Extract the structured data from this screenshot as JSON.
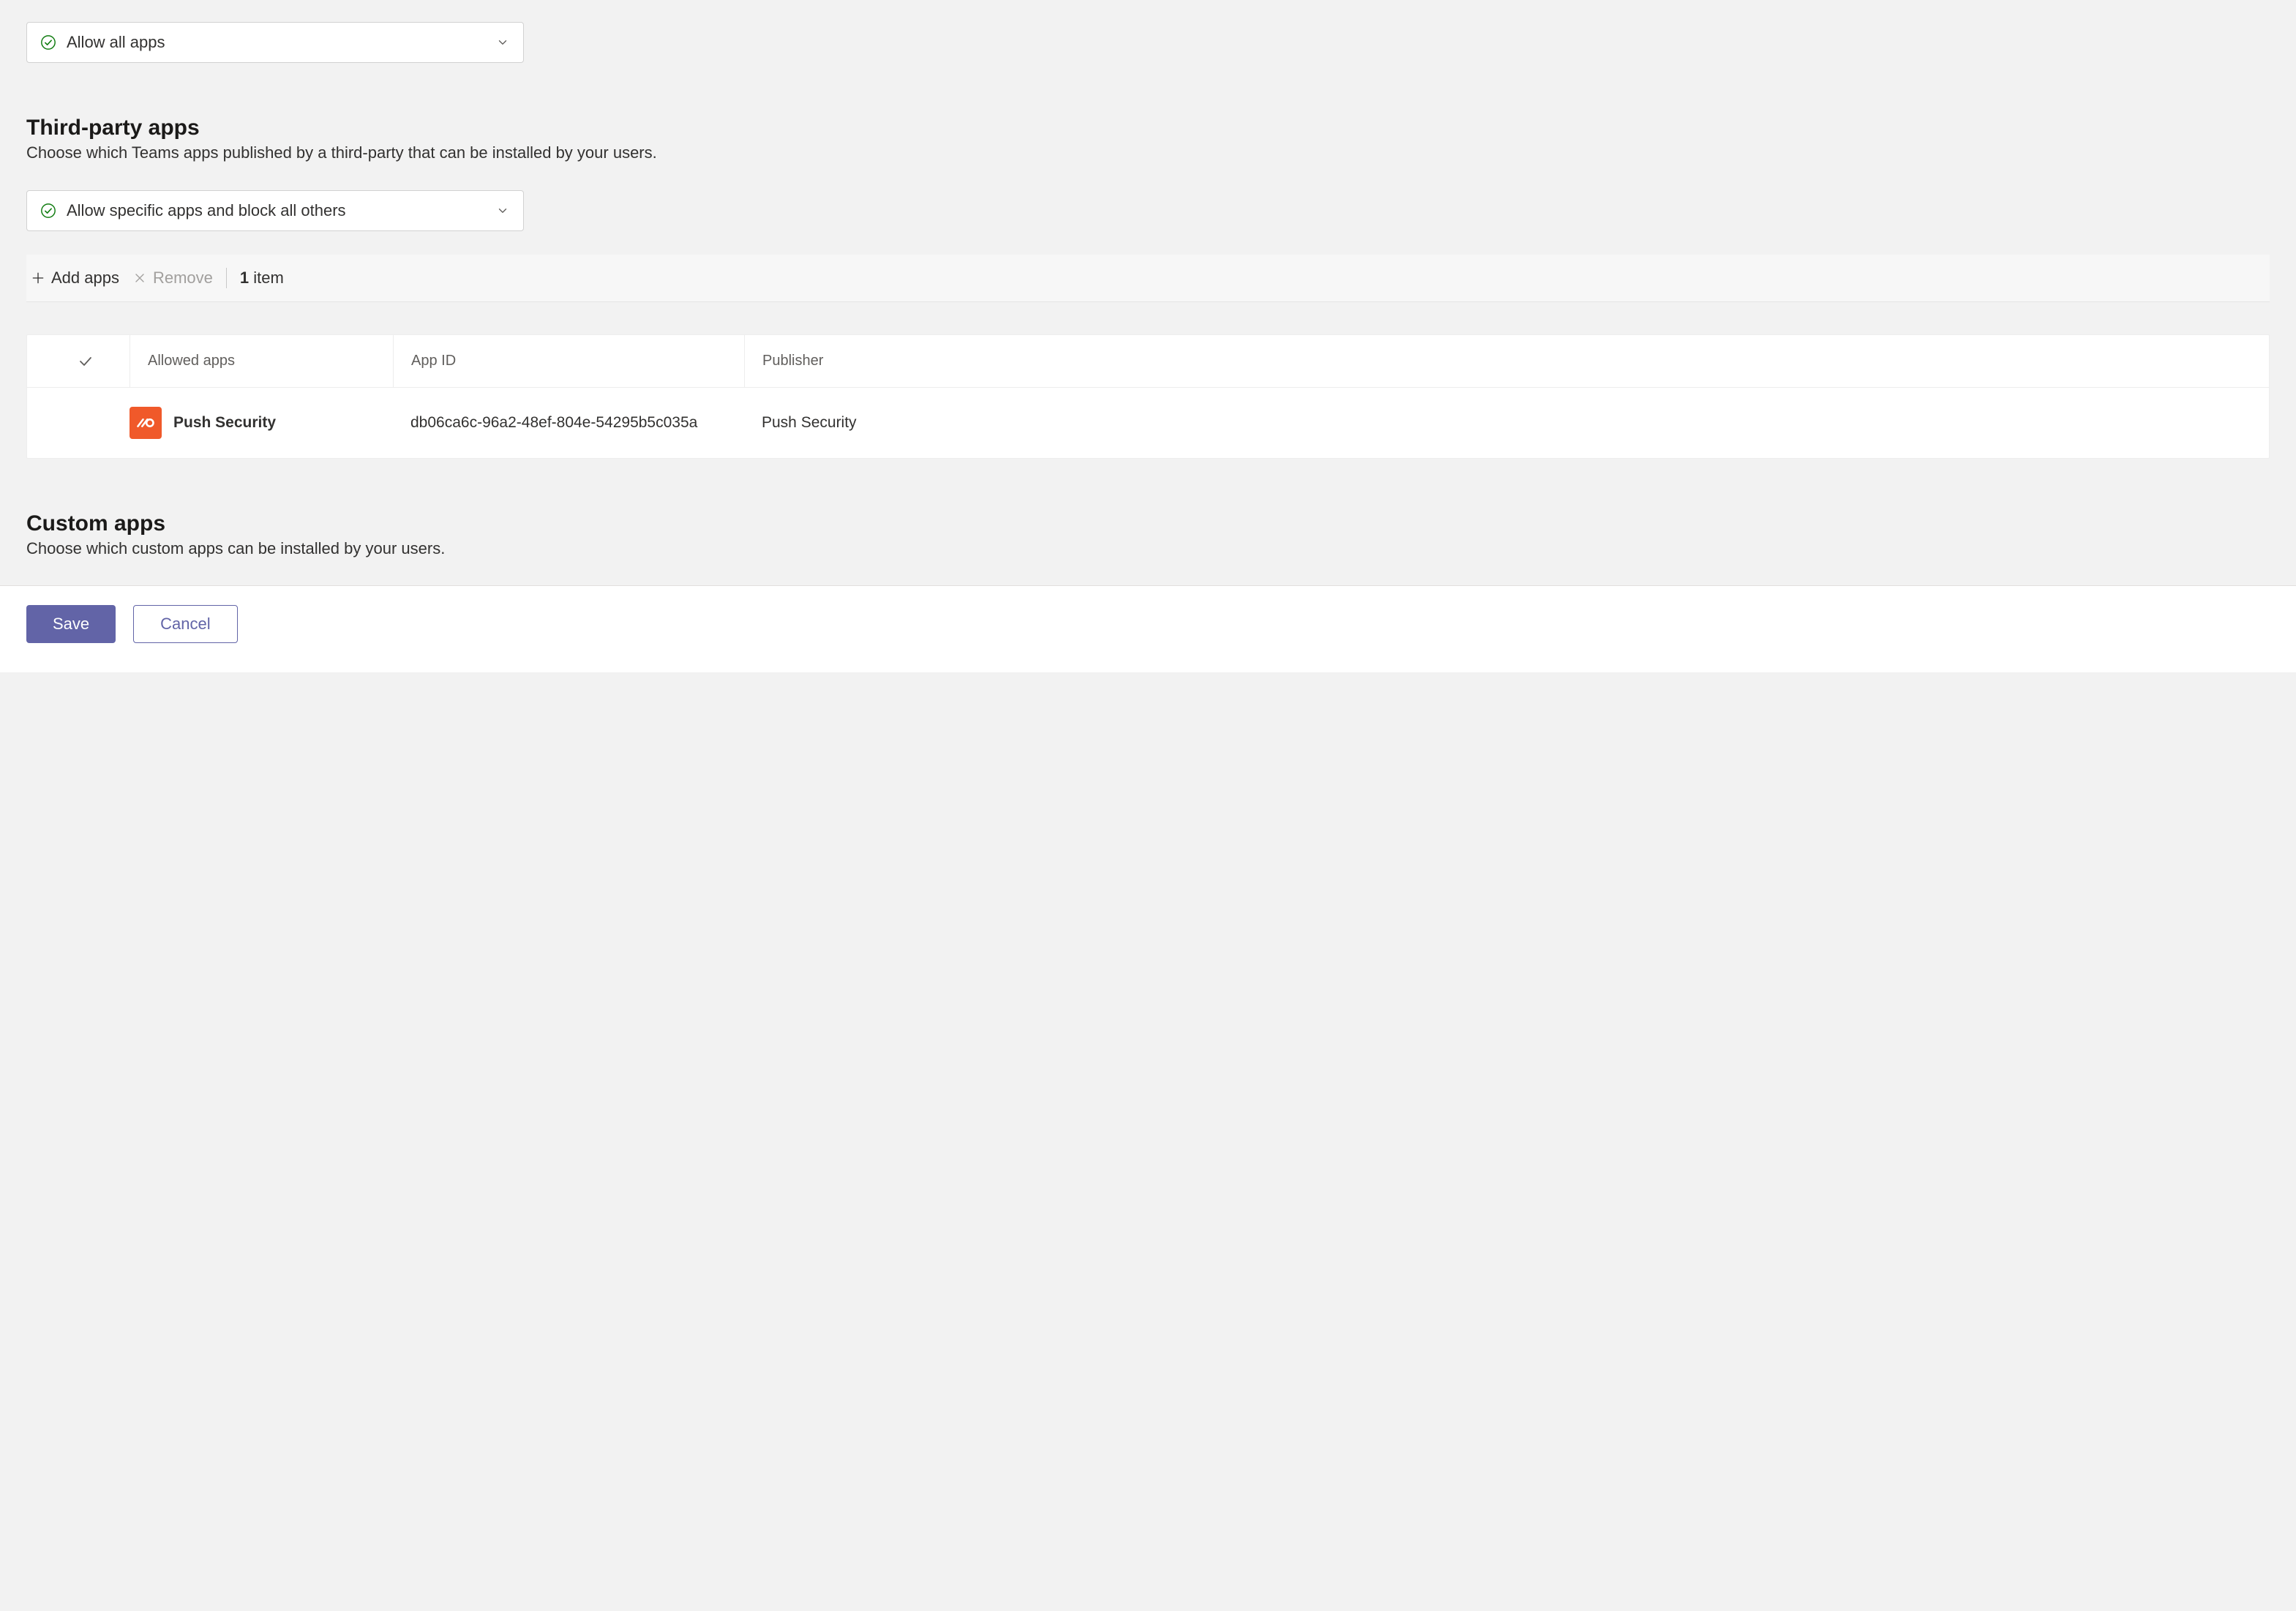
{
  "microsoft_apps": {
    "dropdown": {
      "icon": "checkmark-circle-icon",
      "selected_label": "Allow all apps"
    }
  },
  "third_party": {
    "title": "Third-party apps",
    "description": "Choose which Teams apps published by a third-party that can be installed by your users.",
    "dropdown": {
      "icon": "checkmark-circle-icon",
      "selected_label": "Allow specific apps and block all others"
    },
    "toolbar": {
      "add_label": "Add apps",
      "remove_label": "Remove",
      "item_count": "1",
      "item_count_suffix": " item"
    },
    "table": {
      "columns": {
        "allowed": "Allowed apps",
        "app_id": "App ID",
        "publisher": "Publisher"
      },
      "rows": [
        {
          "app_name": "Push Security",
          "app_id": "db06ca6c-96a2-48ef-804e-54295b5c035a",
          "publisher": "Push Security",
          "icon_bg": "#f0592a"
        }
      ]
    }
  },
  "custom_apps": {
    "title": "Custom apps",
    "description": "Choose which custom apps can be installed by your users."
  },
  "footer": {
    "save_label": "Save",
    "cancel_label": "Cancel"
  },
  "colors": {
    "accent": "#6264a7",
    "brand_orange": "#f0592a",
    "success": "#107c10"
  }
}
